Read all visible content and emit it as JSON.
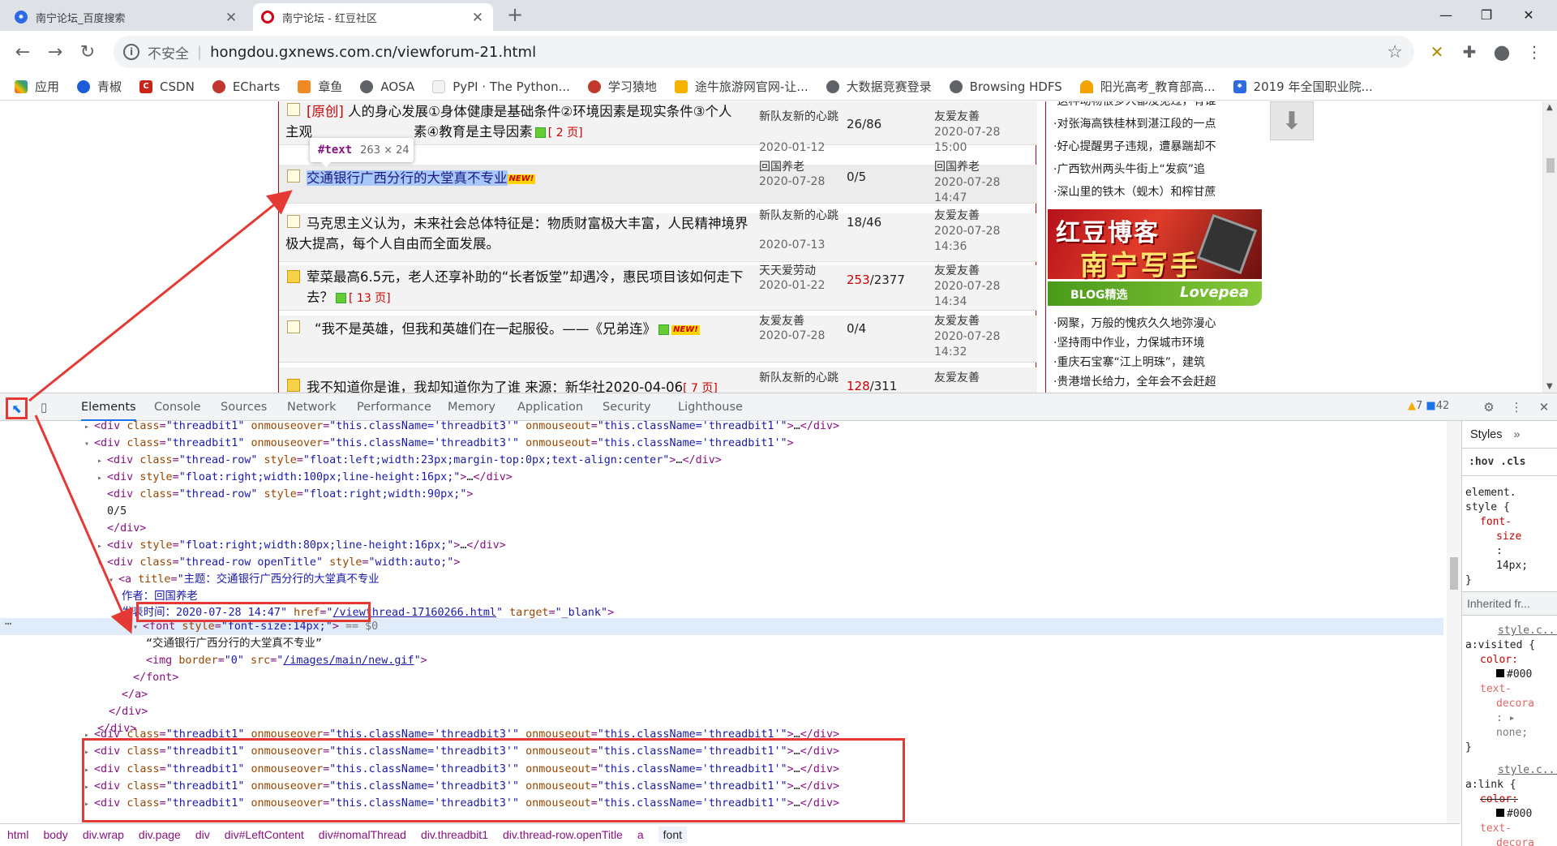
{
  "browser": {
    "tabs": [
      {
        "title": "南宁论坛_百度搜索",
        "icon": "baidu-paw-icon"
      },
      {
        "title": "南宁论坛 - 红豆社区",
        "icon": "hongdou-icon"
      }
    ],
    "security": "不安全",
    "url": "hongdou.gxnews.com.cn/viewforum-21.html",
    "bookmarks": [
      "应用",
      "青椒",
      "CSDN",
      "ECharts",
      "章鱼",
      "AOSA",
      "PyPI · The Python...",
      "学习猿地",
      "途牛旅游网官网-让...",
      "大数据竞赛登录",
      "Browsing HDFS",
      "阳光高考_教育部高...",
      "2019 年全国职业院..."
    ]
  },
  "page": {
    "tooltip": {
      "tag": "#text",
      "dims": "263 × 24"
    },
    "threads": [
      {
        "prefix": "[原创]",
        "title_a": "人的身心发展①身体健康是基础条件②环境因素是现实条件③个人",
        "title_b": "主观",
        "title_c": "素④教育是主导因素",
        "pages": "[ 2 页]",
        "author": "新队友新的心跳",
        "date": "2020-01-12",
        "count": "26/86",
        "last_user": "友爱友善",
        "last_date": "2020-07-28",
        "last_time": "15:00"
      },
      {
        "title": "交通银行广西分行的大堂真不专业",
        "new": "NEW!",
        "author": "回国养老",
        "date": "2020-07-28",
        "count": "0/5",
        "last_user": "回国养老",
        "last_date": "2020-07-28",
        "last_time": "14:47"
      },
      {
        "title": "马克思主义认为，未来社会总体特征是：物质财富极大丰富，人民精神境界极大提高，每个人自由而全面发展。",
        "author": "新队友新的心跳",
        "date": "2020-07-13",
        "count": "18/46",
        "last_user": "友爱友善",
        "last_date": "2020-07-28",
        "last_time": "14:36"
      },
      {
        "title": "荤菜最高6.5元，老人还享补助的“长者饭堂”却遇冷，惠民项目该如何走下去？",
        "pages": "[ 13 页]",
        "author": "天天爱劳动",
        "date": "2020-01-22",
        "count_red": "253",
        "count_rest": "/2377",
        "last_user": "友爱友善",
        "last_date": "2020-07-28",
        "last_time": "14:34"
      },
      {
        "title": "“我不是英雄，但我和英雄们在一起服役。——《兄弟连》",
        "new": "NEW!",
        "author": "友爱友善",
        "date": "2020-07-28",
        "count": "0/4",
        "last_user": "友爱友善",
        "last_date": "2020-07-28",
        "last_time": "14:32"
      },
      {
        "title": "我不知道你是谁，我却知道你为了谁 来源：新华社2020-04-06",
        "pages": "[ 7 页]",
        "author": "新队友新的心跳",
        "count_red": "128",
        "count_rest": "/311",
        "last_user": "友爱友善"
      }
    ],
    "right_news_top": [
      "·这种动物很多人都没见过，有谁",
      "·对张海高铁桂林到湛江段的一点",
      "·好心提醒男子违规，遭暴踹却不",
      "·广西钦州两头牛街上“发疯”追",
      "·深山里的铁木（蚬木）和榨甘蔗"
    ],
    "banner": {
      "line1": "红豆博客",
      "line2": "南宁写手",
      "blog_label": "BLOG精选",
      "blog_brand": "Lovepea"
    },
    "right_news_bottom": [
      "·网聚，万般的愧疚久久地弥漫心",
      "·坚持雨中作业，力保城市环境",
      "·重庆石宝寨“江上明珠”，建筑",
      "·贵港增长给力，全年会不会赶超"
    ]
  },
  "devtools": {
    "tabs": [
      "Elements",
      "Console",
      "Sources",
      "Network",
      "Performance",
      "Memory",
      "Application",
      "Security",
      "Lighthouse"
    ],
    "warnings": "7",
    "messages": "42",
    "dom": {
      "top_partial": "<div class=\"threadbit1\" onmouseover=\"this.className='threadbit3'\" onmouseout=\"this.className='threadbit1'\">…</div>",
      "wrap_div_class": "threadbit1",
      "over": "this.className='threadbit3'",
      "out": "this.className='threadbit1'",
      "c1_class": "thread-row",
      "c1_style": "float:left;width:23px;margin-top:0px;text-align:center",
      "c2_style": "float:right;width:100px;line-height:16px;",
      "c3_class": "thread-row",
      "c3_style": "float:right;width:90px;",
      "c3_text": "0/5",
      "c4_style": "float:right;width:80px;line-height:16px;",
      "c5_class": "thread-row openTitle",
      "c5_style": "width:auto;",
      "a_title_1": "主题：交通银行广西分行的大堂真不专业",
      "a_title_2": "作者：回国养老",
      "a_title_3": "发表时间：2020-07-28 14:47",
      "a_href": "/viewthread-17160266.html",
      "a_target": "_blank",
      "font_style": "font-size:14px;",
      "eq": "== $0",
      "text_node": "“交通银行广西分行的大堂真不专业”",
      "img_border": "0",
      "img_src": "/images/main/new.gif",
      "siblings": 5
    },
    "breadcrumbs": [
      "html",
      "body",
      "div.wrap",
      "div.page",
      "div",
      "div#LeftContent",
      "div#nomalThread",
      "div.threadbit1",
      "div.thread-row.openTitle",
      "a",
      "font"
    ],
    "styles": {
      "tab": "Styles",
      "filter": ":hov .cls",
      "element_style_sel": "element.",
      "element_style_sel2": "style {",
      "prop1": "font-",
      "prop1b": "size",
      "val1": "14px;",
      "inherited": "Inherited fr...",
      "src1": "style.c...",
      "sel2": "a:visited {",
      "prop2": "color:",
      "val2": "#000",
      "prop3": "text-",
      "prop3b": "decora",
      "val3": "none;",
      "src2": "style.c...",
      "sel3": "a:link {",
      "prop4": "color:",
      "val4": "#000",
      "prop5": "text-",
      "prop5b": "decora"
    }
  },
  "colors": {
    "accent": "#1a73e8",
    "annotation": "#e53935",
    "forum_border": "#cc0000",
    "tag": "#881280",
    "attr_name": "#994500",
    "attr_value": "#1a1aa6"
  }
}
